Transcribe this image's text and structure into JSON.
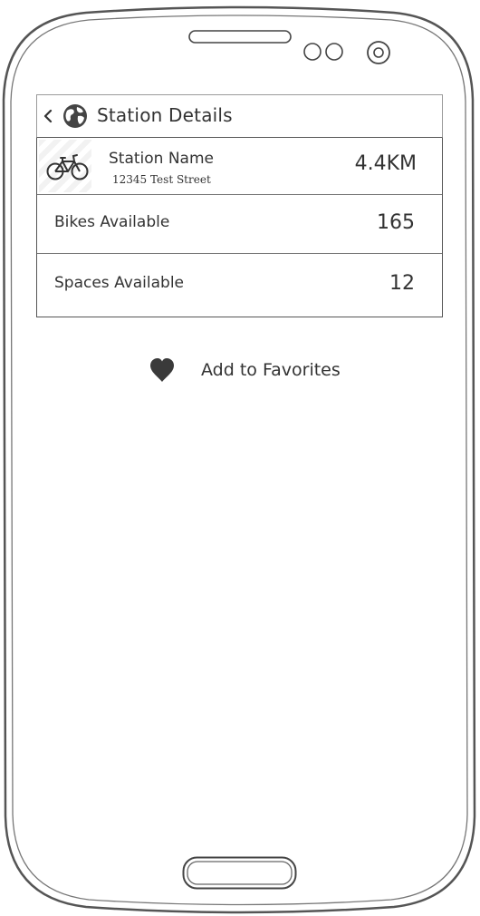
{
  "header": {
    "title": "Station Details",
    "back_icon": "chevron-left-icon",
    "globe_icon": "globe-icon"
  },
  "station": {
    "icon": "bicycle-icon",
    "name": "Station Name",
    "address": "12345 Test Street",
    "distance": "4.4KM"
  },
  "details": [
    {
      "label": "Bikes Available",
      "value": "165"
    },
    {
      "label": "Spaces Available",
      "value": "12"
    }
  ],
  "favorites": {
    "label": "Add to Favorites",
    "icon": "heart-icon"
  },
  "colors": {
    "ink": "#333333",
    "border": "#555555",
    "frame": "#4a4a4a"
  }
}
